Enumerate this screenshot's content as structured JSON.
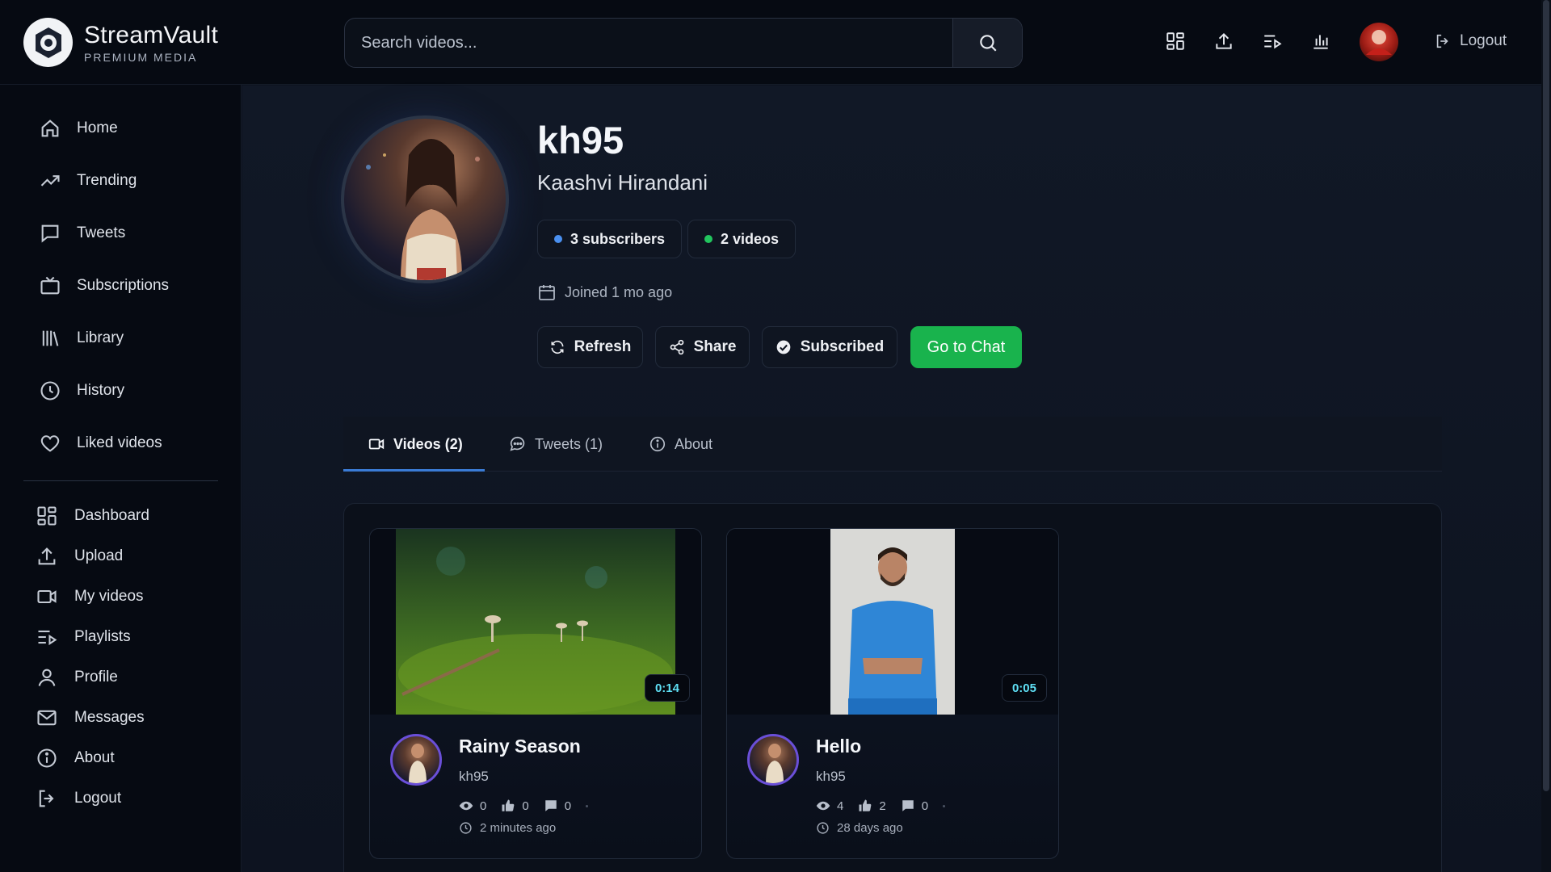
{
  "brand": {
    "name": "StreamVault",
    "subtitle": "PREMIUM MEDIA"
  },
  "search": {
    "placeholder": "Search videos..."
  },
  "topbar": {
    "logout_label": "Logout"
  },
  "sidebar": {
    "primary": [
      {
        "label": "Home",
        "icon": "home-icon"
      },
      {
        "label": "Trending",
        "icon": "trending-icon"
      },
      {
        "label": "Tweets",
        "icon": "tweets-icon"
      },
      {
        "label": "Subscriptions",
        "icon": "subscriptions-icon"
      },
      {
        "label": "Library",
        "icon": "library-icon"
      },
      {
        "label": "History",
        "icon": "history-icon"
      },
      {
        "label": "Liked videos",
        "icon": "heart-icon"
      }
    ],
    "secondary": [
      {
        "label": "Dashboard",
        "icon": "dashboard-icon"
      },
      {
        "label": "Upload",
        "icon": "upload-icon"
      },
      {
        "label": "My videos",
        "icon": "video-icon"
      },
      {
        "label": "Playlists",
        "icon": "playlist-icon"
      },
      {
        "label": "Profile",
        "icon": "user-icon"
      },
      {
        "label": "Messages",
        "icon": "mail-icon"
      },
      {
        "label": "About",
        "icon": "info-icon"
      },
      {
        "label": "Logout",
        "icon": "logout-icon"
      }
    ]
  },
  "profile": {
    "username": "kh95",
    "fullname": "Kaashvi Hirandani",
    "subscribers": "3 subscribers",
    "videos": "2 videos",
    "joined": "Joined 1 mo ago"
  },
  "actions": {
    "refresh": "Refresh",
    "share": "Share",
    "subscribed": "Subscribed",
    "chat": "Go to Chat"
  },
  "tabs": [
    {
      "label": "Videos (2)",
      "active": true
    },
    {
      "label": "Tweets (1)",
      "active": false
    },
    {
      "label": "About",
      "active": false
    }
  ],
  "videos": [
    {
      "title": "Rainy Season",
      "owner": "kh95",
      "duration": "0:14",
      "views": "0",
      "likes": "0",
      "comments": "0",
      "age": "2 minutes ago"
    },
    {
      "title": "Hello",
      "owner": "kh95",
      "duration": "0:05",
      "views": "4",
      "likes": "2",
      "comments": "0",
      "age": "28 days ago"
    }
  ],
  "colors": {
    "accent_green": "#19b34d",
    "subscriber_dot": "#4a90f0",
    "video_dot": "#22c55e",
    "duration_text": "#5fe0f5"
  }
}
